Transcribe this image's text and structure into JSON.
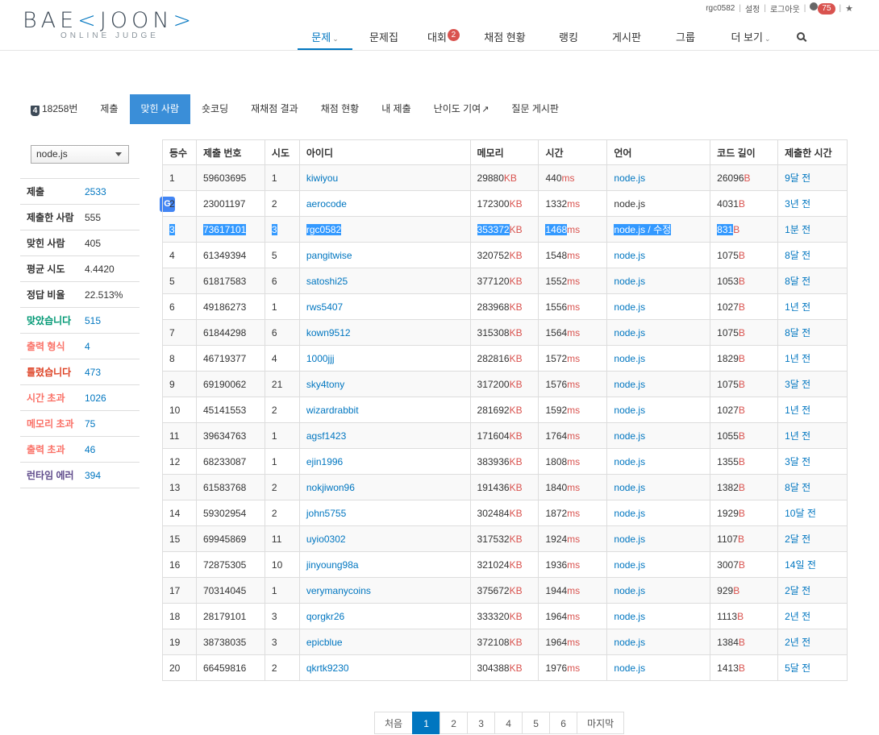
{
  "header": {
    "logo": {
      "prefix": "BAE",
      "bracket_left": "<",
      "middle": "JOON",
      "bracket_right": ">",
      "sub": "ONLINE JUDGE"
    },
    "userbar": {
      "username": "rgc0582",
      "settings": "설정",
      "logout": "로그아웃",
      "notif_count": "75",
      "star": "★"
    },
    "nav": [
      {
        "label": "문제",
        "caret": "⌄",
        "active": true
      },
      {
        "label": "문제집"
      },
      {
        "label": "대회",
        "badge": "2"
      },
      {
        "label": "채점 현황"
      },
      {
        "label": "랭킹"
      },
      {
        "label": "게시판"
      },
      {
        "label": "그룹"
      },
      {
        "label": "더 보기",
        "caret": "⌄"
      }
    ]
  },
  "subtabs": {
    "problem_badge": "4",
    "problem_num": "18258번",
    "items": [
      "제출",
      "맞힌 사람",
      "숏코딩",
      "재채점 결과",
      "채점 현황",
      "내 제출",
      "난이도 기여",
      "질문 게시판"
    ],
    "active": "맞힌 사람",
    "external_icon": "↗"
  },
  "sidebar": {
    "language_select": "node.js",
    "stats": [
      {
        "label": "제출",
        "value": "2533",
        "label_color": "#333333",
        "link": true
      },
      {
        "label": "제출한 사람",
        "value": "555",
        "label_color": "#333333",
        "link": false
      },
      {
        "label": "맞힌 사람",
        "value": "405",
        "label_color": "#333333",
        "link": false
      },
      {
        "label": "평균 시도",
        "value": "4.4420",
        "label_color": "#333333",
        "link": false
      },
      {
        "label": "정답 비율",
        "value": "22.513%",
        "label_color": "#333333",
        "link": false
      },
      {
        "label": "맞았습니다",
        "value": "515",
        "label_color": "#009874",
        "link": true
      },
      {
        "label": "출력 형식",
        "value": "4",
        "label_color": "#fa7268",
        "link": true
      },
      {
        "label": "틀렸습니다",
        "value": "473",
        "label_color": "#dd4124",
        "link": true
      },
      {
        "label": "시간 초과",
        "value": "1026",
        "label_color": "#fa7268",
        "link": true
      },
      {
        "label": "메모리 초과",
        "value": "75",
        "label_color": "#fa7268",
        "link": true
      },
      {
        "label": "출력 초과",
        "value": "46",
        "label_color": "#fa7268",
        "link": true
      },
      {
        "label": "런타임 에러",
        "value": "394",
        "label_color": "#5f4b8b",
        "link": true
      }
    ]
  },
  "table": {
    "columns": [
      "등수",
      "제출 번호",
      "시도",
      "아이디",
      "메모리",
      "시간",
      "언어",
      "코드 길이",
      "제출한 시간"
    ],
    "units": {
      "memory": "KB",
      "time": "ms",
      "code": "B"
    },
    "rows": [
      {
        "rank": "1",
        "sub": "59603695",
        "try": "1",
        "id": "kiwiyou",
        "mem": "29880",
        "time": "440",
        "lang": "node.js",
        "code": "26096",
        "when": "9달 전",
        "lang_link": true
      },
      {
        "rank": "2",
        "sub": "23001197",
        "try": "2",
        "id": "aerocode",
        "mem": "172300",
        "time": "1332",
        "lang": "node.js",
        "code": "4031",
        "when": "3년 전",
        "lang_link": false
      },
      {
        "rank": "3",
        "sub": "73617101",
        "try": "3",
        "id": "rgc0582",
        "mem": "353372",
        "time": "1468",
        "lang": "node.js / 수정",
        "code": "831",
        "when": "1분 전",
        "lang_link": true,
        "highlight": true
      },
      {
        "rank": "4",
        "sub": "61349394",
        "try": "5",
        "id": "pangitwise",
        "mem": "320752",
        "time": "1548",
        "lang": "node.js",
        "code": "1075",
        "when": "8달 전",
        "lang_link": true
      },
      {
        "rank": "5",
        "sub": "61817583",
        "try": "6",
        "id": "satoshi25",
        "mem": "377120",
        "time": "1552",
        "lang": "node.js",
        "code": "1053",
        "when": "8달 전",
        "lang_link": true
      },
      {
        "rank": "6",
        "sub": "49186273",
        "try": "1",
        "id": "rws5407",
        "mem": "283968",
        "time": "1556",
        "lang": "node.js",
        "code": "1027",
        "when": "1년 전",
        "lang_link": true
      },
      {
        "rank": "7",
        "sub": "61844298",
        "try": "6",
        "id": "kown9512",
        "mem": "315308",
        "time": "1564",
        "lang": "node.js",
        "code": "1075",
        "when": "8달 전",
        "lang_link": true
      },
      {
        "rank": "8",
        "sub": "46719377",
        "try": "4",
        "id": "1000jjj",
        "mem": "282816",
        "time": "1572",
        "lang": "node.js",
        "code": "1829",
        "when": "1년 전",
        "lang_link": true
      },
      {
        "rank": "9",
        "sub": "69190062",
        "try": "21",
        "id": "sky4tony",
        "mem": "317200",
        "time": "1576",
        "lang": "node.js",
        "code": "1075",
        "when": "3달 전",
        "lang_link": true
      },
      {
        "rank": "10",
        "sub": "45141553",
        "try": "2",
        "id": "wizardrabbit",
        "mem": "281692",
        "time": "1592",
        "lang": "node.js",
        "code": "1027",
        "when": "1년 전",
        "lang_link": true
      },
      {
        "rank": "11",
        "sub": "39634763",
        "try": "1",
        "id": "agsf1423",
        "mem": "171604",
        "time": "1764",
        "lang": "node.js",
        "code": "1055",
        "when": "1년 전",
        "lang_link": true
      },
      {
        "rank": "12",
        "sub": "68233087",
        "try": "1",
        "id": "ejin1996",
        "mem": "383936",
        "time": "1808",
        "lang": "node.js",
        "code": "1355",
        "when": "3달 전",
        "lang_link": true
      },
      {
        "rank": "13",
        "sub": "61583768",
        "try": "2",
        "id": "nokjiwon96",
        "mem": "191436",
        "time": "1840",
        "lang": "node.js",
        "code": "1382",
        "when": "8달 전",
        "lang_link": true
      },
      {
        "rank": "14",
        "sub": "59302954",
        "try": "2",
        "id": "john5755",
        "mem": "302484",
        "time": "1872",
        "lang": "node.js",
        "code": "1929",
        "when": "10달 전",
        "lang_link": true
      },
      {
        "rank": "15",
        "sub": "69945869",
        "try": "11",
        "id": "uyio0302",
        "mem": "317532",
        "time": "1924",
        "lang": "node.js",
        "code": "1107",
        "when": "2달 전",
        "lang_link": true
      },
      {
        "rank": "16",
        "sub": "72875305",
        "try": "10",
        "id": "jinyoung98a",
        "mem": "321024",
        "time": "1936",
        "lang": "node.js",
        "code": "3007",
        "when": "14일 전",
        "lang_link": true
      },
      {
        "rank": "17",
        "sub": "70314045",
        "try": "1",
        "id": "verymanycoins",
        "mem": "375672",
        "time": "1944",
        "lang": "node.js",
        "code": "929",
        "when": "2달 전",
        "lang_link": true
      },
      {
        "rank": "18",
        "sub": "28179101",
        "try": "3",
        "id": "qorgkr26",
        "mem": "333320",
        "time": "1964",
        "lang": "node.js",
        "code": "1113",
        "when": "2년 전",
        "lang_link": true
      },
      {
        "rank": "19",
        "sub": "38738035",
        "try": "3",
        "id": "epicblue",
        "mem": "372108",
        "time": "1964",
        "lang": "node.js",
        "code": "1384",
        "when": "2년 전",
        "lang_link": true
      },
      {
        "rank": "20",
        "sub": "66459816",
        "try": "2",
        "id": "qkrtk9230",
        "mem": "304388",
        "time": "1976",
        "lang": "node.js",
        "code": "1413",
        "when": "5달 전",
        "lang_link": true
      }
    ]
  },
  "pagination": {
    "first": "처음",
    "pages": [
      "1",
      "2",
      "3",
      "4",
      "5",
      "6"
    ],
    "last": "마지막",
    "current": "1"
  },
  "colors": {
    "accent": "#0076c0",
    "tab_active": "#3a8ed8",
    "unit_red": "#d9534f",
    "selection": "#3399ff"
  },
  "translate_icon": "G"
}
